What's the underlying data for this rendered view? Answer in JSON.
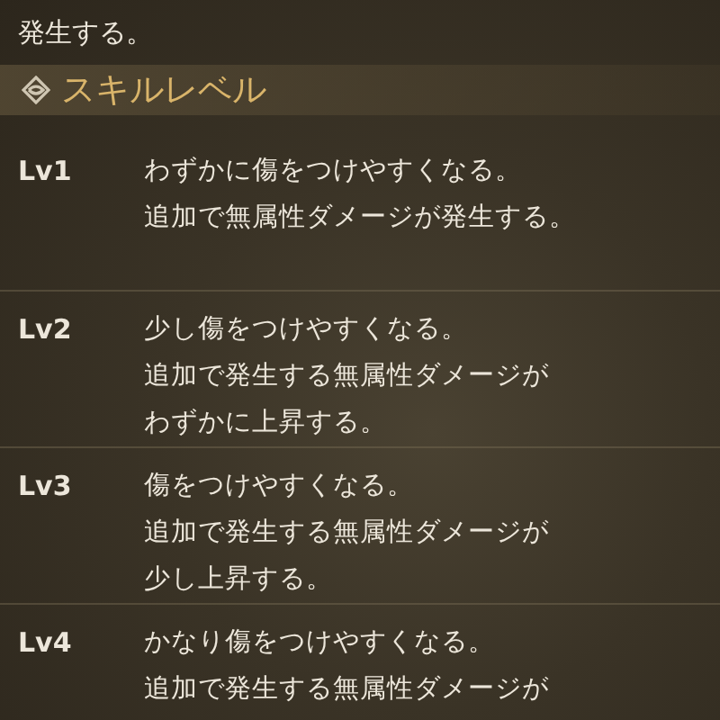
{
  "intro_tail": "発生する。",
  "section": {
    "title": "スキルレベル"
  },
  "levels": [
    {
      "label": "Lv1",
      "lines": [
        "わずかに傷をつけやすくなる。",
        "追加で無属性ダメージが発生する。"
      ]
    },
    {
      "label": "Lv2",
      "lines": [
        "少し傷をつけやすくなる。",
        "追加で発生する無属性ダメージが",
        "わずかに上昇する。"
      ]
    },
    {
      "label": "Lv3",
      "lines": [
        "傷をつけやすくなる。",
        "追加で発生する無属性ダメージが",
        "少し上昇する。"
      ]
    },
    {
      "label": "Lv4",
      "lines": [
        "かなり傷をつけやすくなる。",
        "追加で発生する無属性ダメージが"
      ]
    }
  ]
}
